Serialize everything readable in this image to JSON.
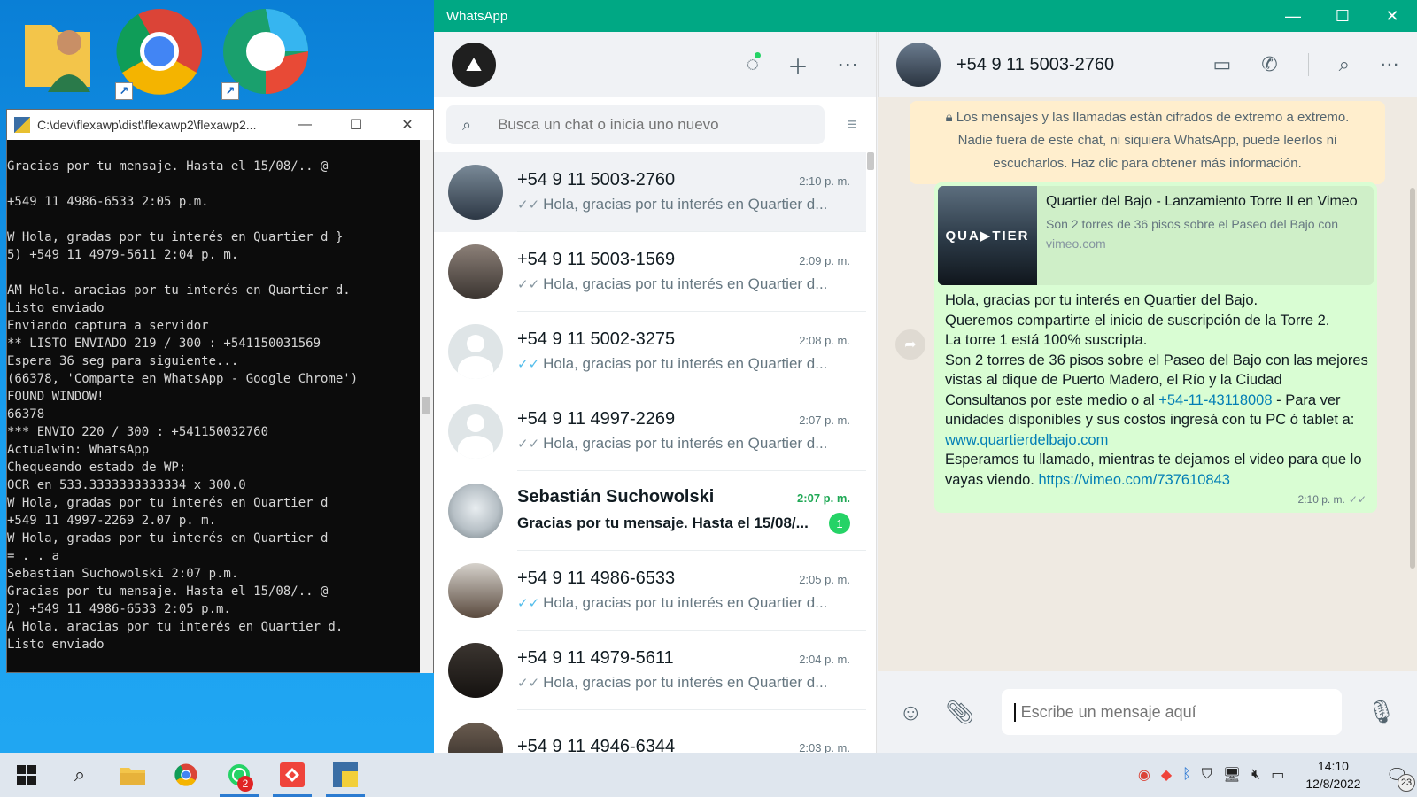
{
  "console": {
    "title": "C:\\dev\\flexawp\\dist\\flexawp2\\flexawp2...",
    "lines": "Gracias por tu mensaje. Hasta el 15/08/.. @\n\n+549 11 4986-6533 2:05 p.m.\n\nW Hola, gradas por tu interés en Quartier d }\n5) +549 11 4979-5611 2:04 p. m.\n\nAM Hola. aracias por tu interés en Quartier d.\nListo enviado\nEnviando captura a servidor\n** LISTO ENVIADO 219 / 300 : +541150031569\nEspera 36 seg para siguiente...\n(66378, 'Comparte en WhatsApp - Google Chrome')\nFOUND WINDOW!\n66378\n*** ENVIO 220 / 300 : +541150032760\nActualwin: WhatsApp\nChequeando estado de WP:\nOCR en 533.3333333333334 x 300.0\nW Hola, gradas por tu interés en Quartier d\n+549 11 4997-2269 2.07 p. m.\nW Hola, gradas por tu interés en Quartier d\n= . . a\nSebastian Suchowolski 2:07 p.m.\nGracias por tu mensaje. Hasta el 15/08/.. @\n2) +549 11 4986-6533 2:05 p.m.\nA Hola. aracias por tu interés en Quartier d.\nListo enviado"
  },
  "whatsapp": {
    "window_title": "WhatsApp",
    "search_placeholder": "Busca un chat o inicia uno nuevo",
    "chats": [
      {
        "name": "+54 9 11 5003-2760",
        "time": "2:10 p. m.",
        "preview": "Hola, gracias por tu interés en Quartier d...",
        "tick": "read-gray"
      },
      {
        "name": "+54 9 11 5003-1569",
        "time": "2:09 p. m.",
        "preview": "Hola, gracias por tu interés en Quartier d...",
        "tick": "read-gray"
      },
      {
        "name": "+54 9 11 5002-3275",
        "time": "2:08 p. m.",
        "preview": "Hola, gracias por tu interés en Quartier d...",
        "tick": "read-blue"
      },
      {
        "name": "+54 9 11 4997-2269",
        "time": "2:07 p. m.",
        "preview": "Hola, gracias por tu interés en Quartier d...",
        "tick": "read-gray"
      },
      {
        "name": "Sebastián Suchowolski",
        "time": "2:07 p. m.",
        "preview": "Gracias por tu mensaje.  Hasta el 15/08/...",
        "unread": "1"
      },
      {
        "name": "+54 9 11 4986-6533",
        "time": "2:05 p. m.",
        "preview": "Hola, gracias por tu interés en Quartier d...",
        "tick": "read-blue"
      },
      {
        "name": "+54 9 11 4979-5611",
        "time": "2:04 p. m.",
        "preview": "Hola, gracias por tu interés en Quartier d...",
        "tick": "read-gray"
      },
      {
        "name": "+54 9 11 4946-6344",
        "time": "2:03 p. m.",
        "preview": ""
      }
    ],
    "active_chat": {
      "name": "+54 9 11 5003-2760",
      "encryption_notice": "Los mensajes y las llamadas están cifrados de extremo a extremo. Nadie fuera de este chat, ni siquiera WhatsApp, puede leerlos ni escucharlos. Haz clic para obtener más información.",
      "link_preview": {
        "thumb_text": "QUA▶TIER",
        "title": "Quartier del Bajo - Lanzamiento Torre II en Vimeo",
        "description": "Son 2 torres de 36 pisos sobre el Paseo del Bajo con",
        "domain": "vimeo.com"
      },
      "message": {
        "line1": "Hola, gracias por tu interés en Quartier del Bajo.",
        "line2": "Queremos compartirte el inicio de suscripción de la Torre 2.",
        "line3": "La torre 1 está 100% suscripta.",
        "line4": "Son 2 torres de 36 pisos sobre el Paseo del Bajo con las mejores vistas al dique de Puerto Madero, el Río y la Ciudad",
        "line5_pre": "Consultanos por este medio o al ",
        "phone_link": "+54-11-43118008",
        "line5_post": " - Para ver unidades disponibles y sus costos ingresá con tu PC ó tablet a: ",
        "web_link": "www.quartierdelbajo.com",
        "line6": "Esperamos tu llamado, mientras te dejamos el video para que lo vayas viendo. ",
        "video_link": "https://vimeo.com/737610843",
        "time": "2:10 p. m."
      },
      "composer_placeholder": "Escribe un mensaje aquí"
    }
  },
  "taskbar": {
    "whatsapp_badge": "2",
    "time": "14:10",
    "date": "12/8/2022",
    "notifications": "23"
  }
}
